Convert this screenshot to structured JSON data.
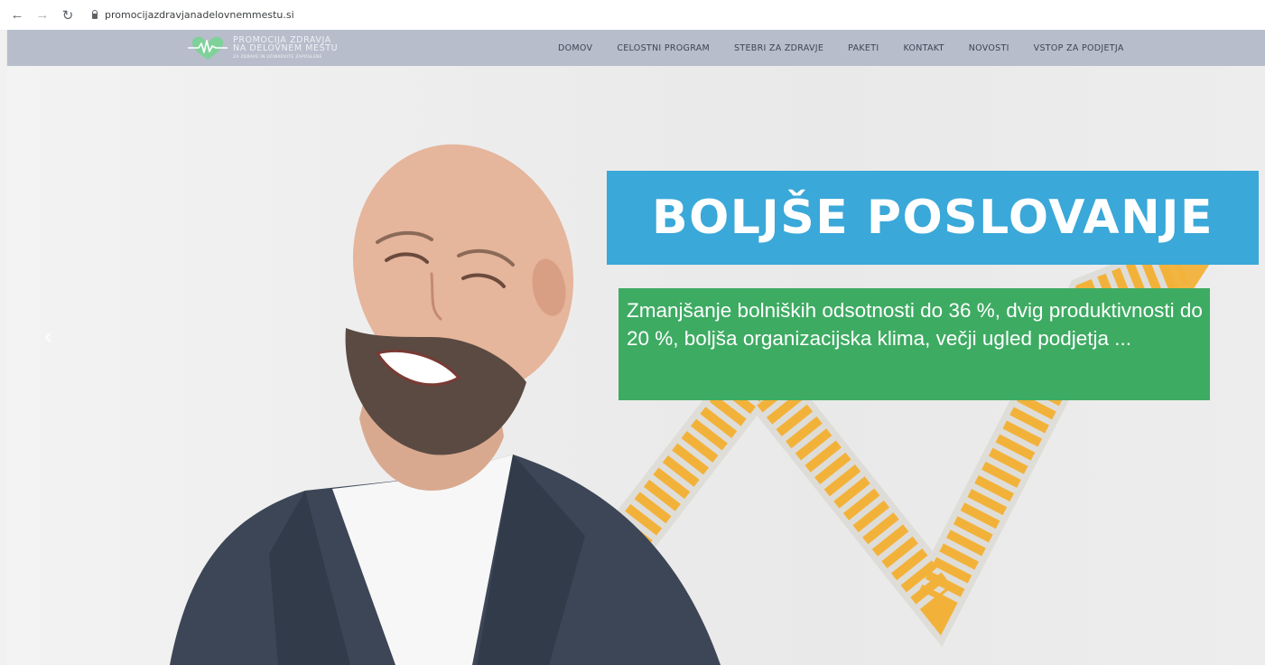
{
  "browser": {
    "back_icon": "arrow-left-icon",
    "forward_icon": "arrow-right-icon",
    "reload_icon": "reload-icon",
    "url": "promocijazdravjanadelovnemmestu.si"
  },
  "header": {
    "logo": {
      "line1": "PROMOCIJA ZDRAVJA",
      "line2": "NA DELOVNEM MESTU",
      "line3": "ZA ZDRAVE IN UČINKOVITE ZAPOSLENE",
      "heart_color": "#7fd19a"
    },
    "nav": [
      {
        "label": "DOMOV"
      },
      {
        "label": "CELOSTNI PROGRAM"
      },
      {
        "label": "STEBRI ZA ZDRAVJE"
      },
      {
        "label": "PAKETI"
      },
      {
        "label": "KONTAKT"
      },
      {
        "label": "NOVOSTI"
      },
      {
        "label": "VSTOP ZA PODJETJA"
      }
    ]
  },
  "hero": {
    "headline": "BOLJŠE POSLOVANJE",
    "subtext": "Zmanjšanje bolniških odsotnosti do 36 %, dvig produktivnosti do 20 %, boljša organizacijska klima, večji ugled podjetja ...",
    "prev_arrow": "‹",
    "colors": {
      "headline_bg": "#3aa8d8",
      "subtext_bg": "#3eab63",
      "chart_line": "#f2b23a"
    }
  }
}
